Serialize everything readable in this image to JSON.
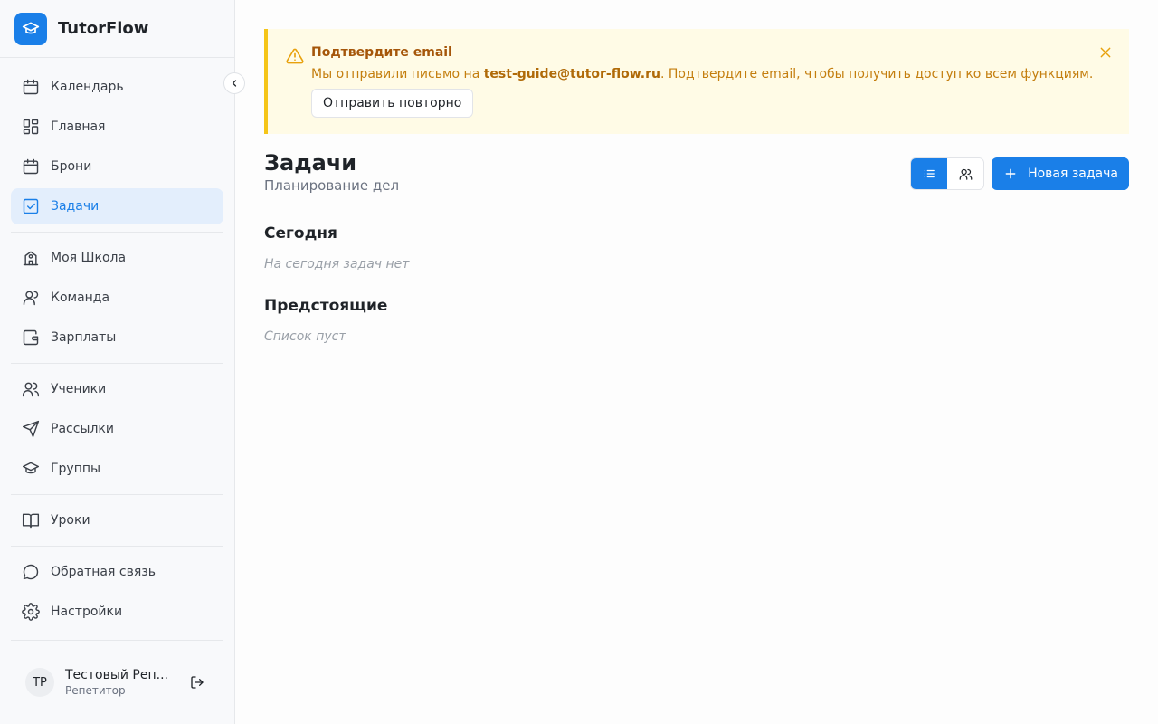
{
  "app": {
    "name": "TutorFlow",
    "brand_color": "#1a7fe8"
  },
  "sidebar": {
    "groups": [
      [
        {
          "label": "Календарь",
          "icon": "calendar-icon",
          "active": false
        },
        {
          "label": "Главная",
          "icon": "dashboard-icon",
          "active": false
        },
        {
          "label": "Брони",
          "icon": "calendar-icon",
          "active": false
        },
        {
          "label": "Задачи",
          "icon": "checkbox-icon",
          "active": true
        }
      ],
      [
        {
          "label": "Моя Школа",
          "icon": "school-icon",
          "active": false
        },
        {
          "label": "Команда",
          "icon": "user-icon",
          "active": false
        },
        {
          "label": "Зарплаты",
          "icon": "wallet-icon",
          "active": false
        }
      ],
      [
        {
          "label": "Ученики",
          "icon": "users-icon",
          "active": false
        },
        {
          "label": "Рассылки",
          "icon": "send-icon",
          "active": false
        },
        {
          "label": "Группы",
          "icon": "graduation-cap-icon",
          "active": false
        }
      ],
      [
        {
          "label": "Уроки",
          "icon": "book-icon",
          "active": false
        }
      ],
      [
        {
          "label": "Обратная связь",
          "icon": "message-icon",
          "active": false
        },
        {
          "label": "Настройки",
          "icon": "gear-icon",
          "active": false
        }
      ]
    ],
    "user": {
      "initials": "ТР",
      "name": "Тестовый Реп...",
      "role": "Репетитор"
    }
  },
  "alert": {
    "title": "Подтвердите email",
    "text_before": "Мы отправили письмо на ",
    "email": "test-guide@tutor-flow.ru",
    "text_after": ". Подтвердите email, чтобы получить доступ ко всем функциям.",
    "resend_label": "Отправить повторно"
  },
  "page": {
    "title": "Задачи",
    "subtitle": "Планирование дел",
    "new_task_label": "Новая задача",
    "sections": [
      {
        "title": "Сегодня",
        "empty": "На сегодня задач нет"
      },
      {
        "title": "Предстоящие",
        "empty": "Список пуст"
      }
    ]
  }
}
